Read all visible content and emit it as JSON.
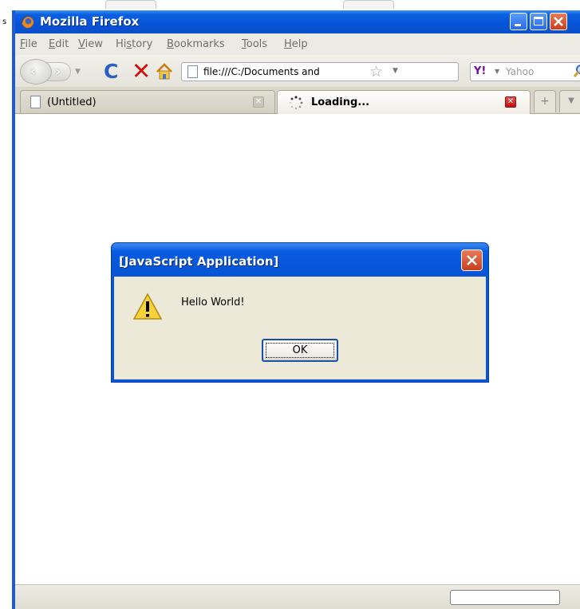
{
  "desktop": {
    "stray_text": "s"
  },
  "window": {
    "title": "Mozilla Firefox",
    "colors": {
      "titlebar": "#0653d8",
      "chrome": "#ecebe3"
    }
  },
  "menubar": {
    "items": [
      {
        "label": "File",
        "access_key": "F",
        "rest": "ile"
      },
      {
        "label": "Edit",
        "access_key": "E",
        "rest": "dit"
      },
      {
        "label": "View",
        "access_key": "V",
        "rest": "iew"
      },
      {
        "label": "History",
        "pre": "Hi",
        "access_key": "s",
        "rest": "tory"
      },
      {
        "label": "Bookmarks",
        "access_key": "B",
        "rest": "ookmarks"
      },
      {
        "label": "Tools",
        "access_key": "T",
        "rest": "ools"
      },
      {
        "label": "Help",
        "access_key": "H",
        "rest": "elp"
      }
    ]
  },
  "navbar": {
    "url": "file:///C:/Documents and",
    "search_engine": "Yahoo",
    "icons": [
      "back-icon",
      "forward-icon",
      "reload-icon",
      "stop-icon",
      "home-icon",
      "star-icon",
      "yahoo-icon",
      "search-icon"
    ]
  },
  "tabs": [
    {
      "label": "(Untitled)",
      "active": false
    },
    {
      "label": "Loading...",
      "active": true
    }
  ],
  "dialog": {
    "title": "[JavaScript Application]",
    "message": "Hello World!",
    "ok_label": "OK",
    "icon": "warning-icon"
  }
}
